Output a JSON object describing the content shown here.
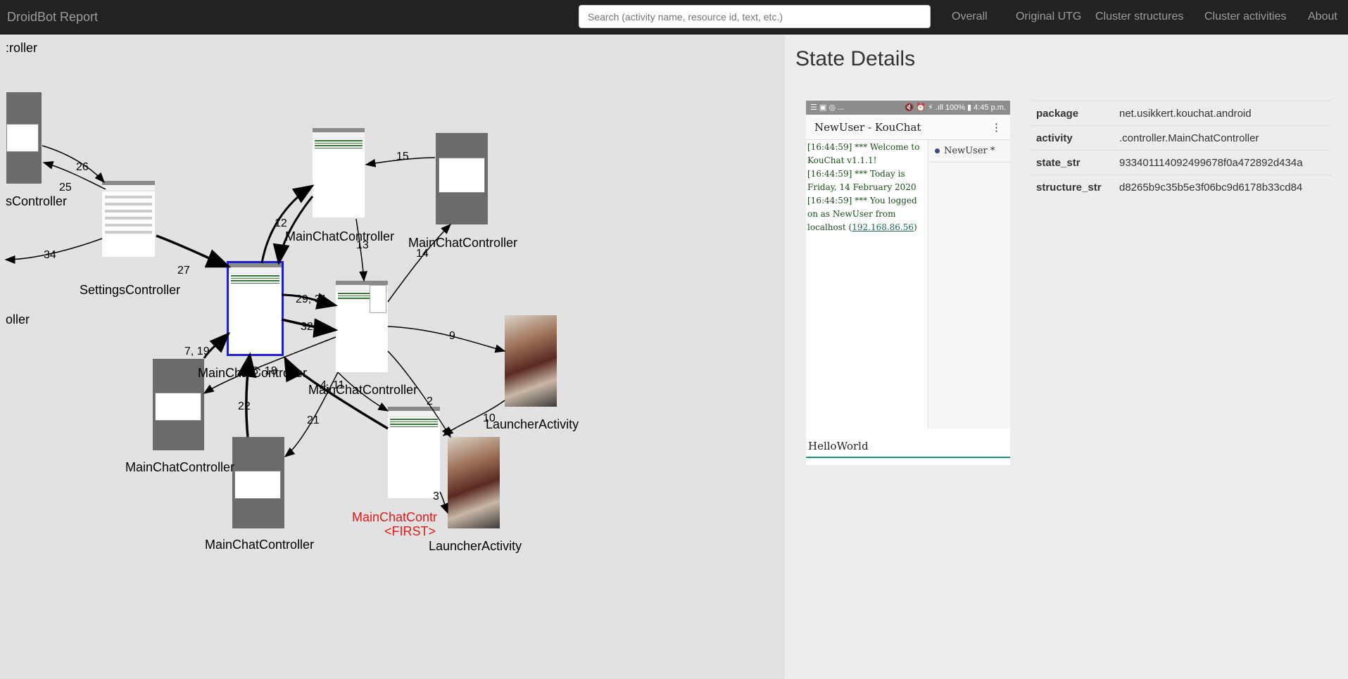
{
  "navbar": {
    "brand": "DroidBot Report",
    "search_placeholder": "Search (activity name, resource id, text, etc.)",
    "links": [
      "Overall",
      "Original UTG",
      "Cluster structures",
      "Cluster activities",
      "About"
    ]
  },
  "graph": {
    "node_labels": {
      "top_left_partial": ":roller",
      "left_partial_settings": "sController",
      "left_partial": "oller",
      "settings": "SettingsController",
      "main_top": "MainChatController",
      "main_top_right": "MainChatController",
      "main_selected": "MainChatController",
      "main_menu": "MainChatController",
      "main_dialog_left": "MainChatController",
      "main_dialog_bottom": "MainChatController",
      "first_name": "MainChatContr",
      "first_tag": "<FIRST>",
      "launcher_right": "LauncherActivity",
      "launcher_bottom": "LauncherActivity"
    },
    "edge_labels": [
      "26",
      "25",
      "34",
      "27",
      "12",
      "15",
      "13",
      "14",
      "29, 31",
      "32",
      "7, 19",
      "6, 18",
      "4, 11",
      "9",
      "2",
      "10",
      "21",
      "22",
      "3"
    ]
  },
  "details": {
    "title": "State Details",
    "screenshot": {
      "status_left": "☰ ▣ ◎ ...",
      "status_right": "🔇 ⏰ ⚡ .ıll 100% ▮ 4:45 p.m.",
      "app_title": "NewUser - KouChat",
      "chat_lines": [
        "[16:44:59] *** Welcome to KouChat v1.1.1!",
        "[16:44:59] *** Today is Friday, 14 February 2020",
        "[16:44:59] *** You logged on as NewUser from localhost"
      ],
      "ip": "192.168.86.56",
      "user": "NewUser *",
      "input_text": "HelloWorld"
    },
    "rows": [
      {
        "key": "package",
        "value": "net.usikkert.kouchat.android"
      },
      {
        "key": "activity",
        "value": ".controller.MainChatController"
      },
      {
        "key": "state_str",
        "value": "933401114092499678f0a472892d434a"
      },
      {
        "key": "structure_str",
        "value": "d8265b9c35b5e3f06bc9d6178b33cd84"
      }
    ]
  },
  "colors": {
    "navbar": "#222222",
    "graph_bg": "#e2e2e2",
    "selected_border": "#1f1fd6",
    "first_label": "#e21a1a",
    "input_underline": "#179479"
  }
}
